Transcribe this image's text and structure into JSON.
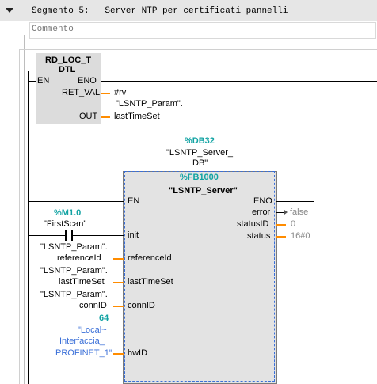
{
  "segment": {
    "title": "Segmento 5:   Server NTP per certificati pannelli",
    "comment_placeholder": "Commento"
  },
  "rd_loc": {
    "name_line1": "RD_LOC_T",
    "name_line2": "DTL",
    "en": "EN",
    "eno": "ENO",
    "ret_val": "RET_VAL",
    "out": "OUT",
    "ret_val_operand": "#rv",
    "out_operand_line1": "\"LSNTP_Param\".",
    "out_operand_line2": "lastTimeSet"
  },
  "fb": {
    "db_address": "%DB32",
    "db_name_line1": "\"LSNTP_Server_",
    "db_name_line2": "DB\"",
    "fb_address": "%FB1000",
    "fb_name": "\"LSNTP_Server\"",
    "inputs": {
      "en": "EN",
      "init": "init",
      "referenceId": "referenceId",
      "lastTimeSet": "lastTimeSet",
      "connID": "connID",
      "hwID": "hwID"
    },
    "outputs": {
      "eno": "ENO",
      "error": "error",
      "statusID": "statusID",
      "status": "status"
    },
    "output_values": {
      "error": "false",
      "statusID": "0",
      "status": "16#0"
    }
  },
  "contact": {
    "address": "%M1.0",
    "name": "\"FirstScan\""
  },
  "operands": {
    "referenceId_line1": "\"LSNTP_Param\".",
    "referenceId_line2": "referenceId",
    "lastTimeSet_line1": "\"LSNTP_Param\".",
    "lastTimeSet_line2": "lastTimeSet",
    "connID_line1": "\"LSNTP_Param\".",
    "connID_line2": "connID",
    "hwID_value": "64",
    "hwID_line1": "\"Local~",
    "hwID_line2": "Interfaccia_",
    "hwID_line3": "PROFINET_1\""
  },
  "colors": {
    "address": "#12a3a3",
    "constant_blue": "#3a6fd8",
    "wire_orange": "#ff8c00",
    "header_bg": "#e6e6e6",
    "box_bg": "#dcdcdc"
  }
}
